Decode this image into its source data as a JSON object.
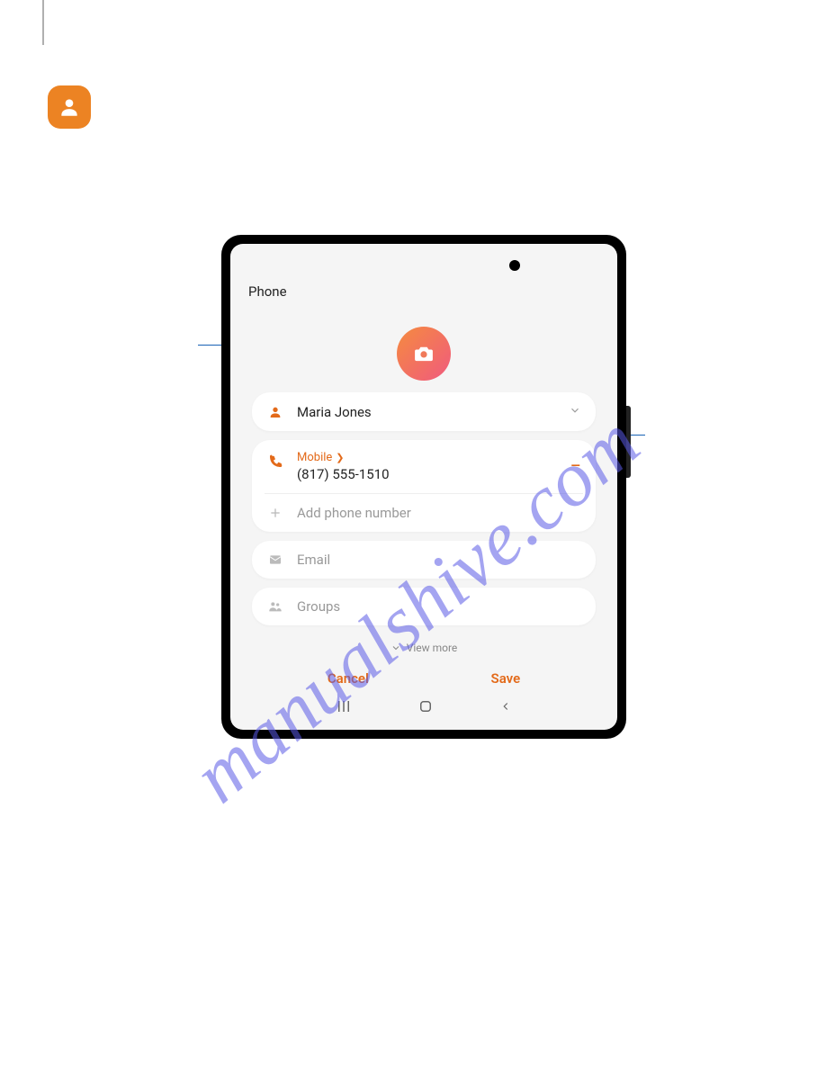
{
  "watermark": "manualshive.com",
  "screen": {
    "storageLabel": "Phone",
    "name": "Maria Jones",
    "phone": {
      "typeLabel": "Mobile",
      "number": "(817) 555-1510"
    },
    "addPhoneLabel": "Add phone number",
    "emailLabel": "Email",
    "groupsLabel": "Groups",
    "viewMoreLabel": "View more",
    "cancelLabel": "Cancel",
    "saveLabel": "Save"
  }
}
